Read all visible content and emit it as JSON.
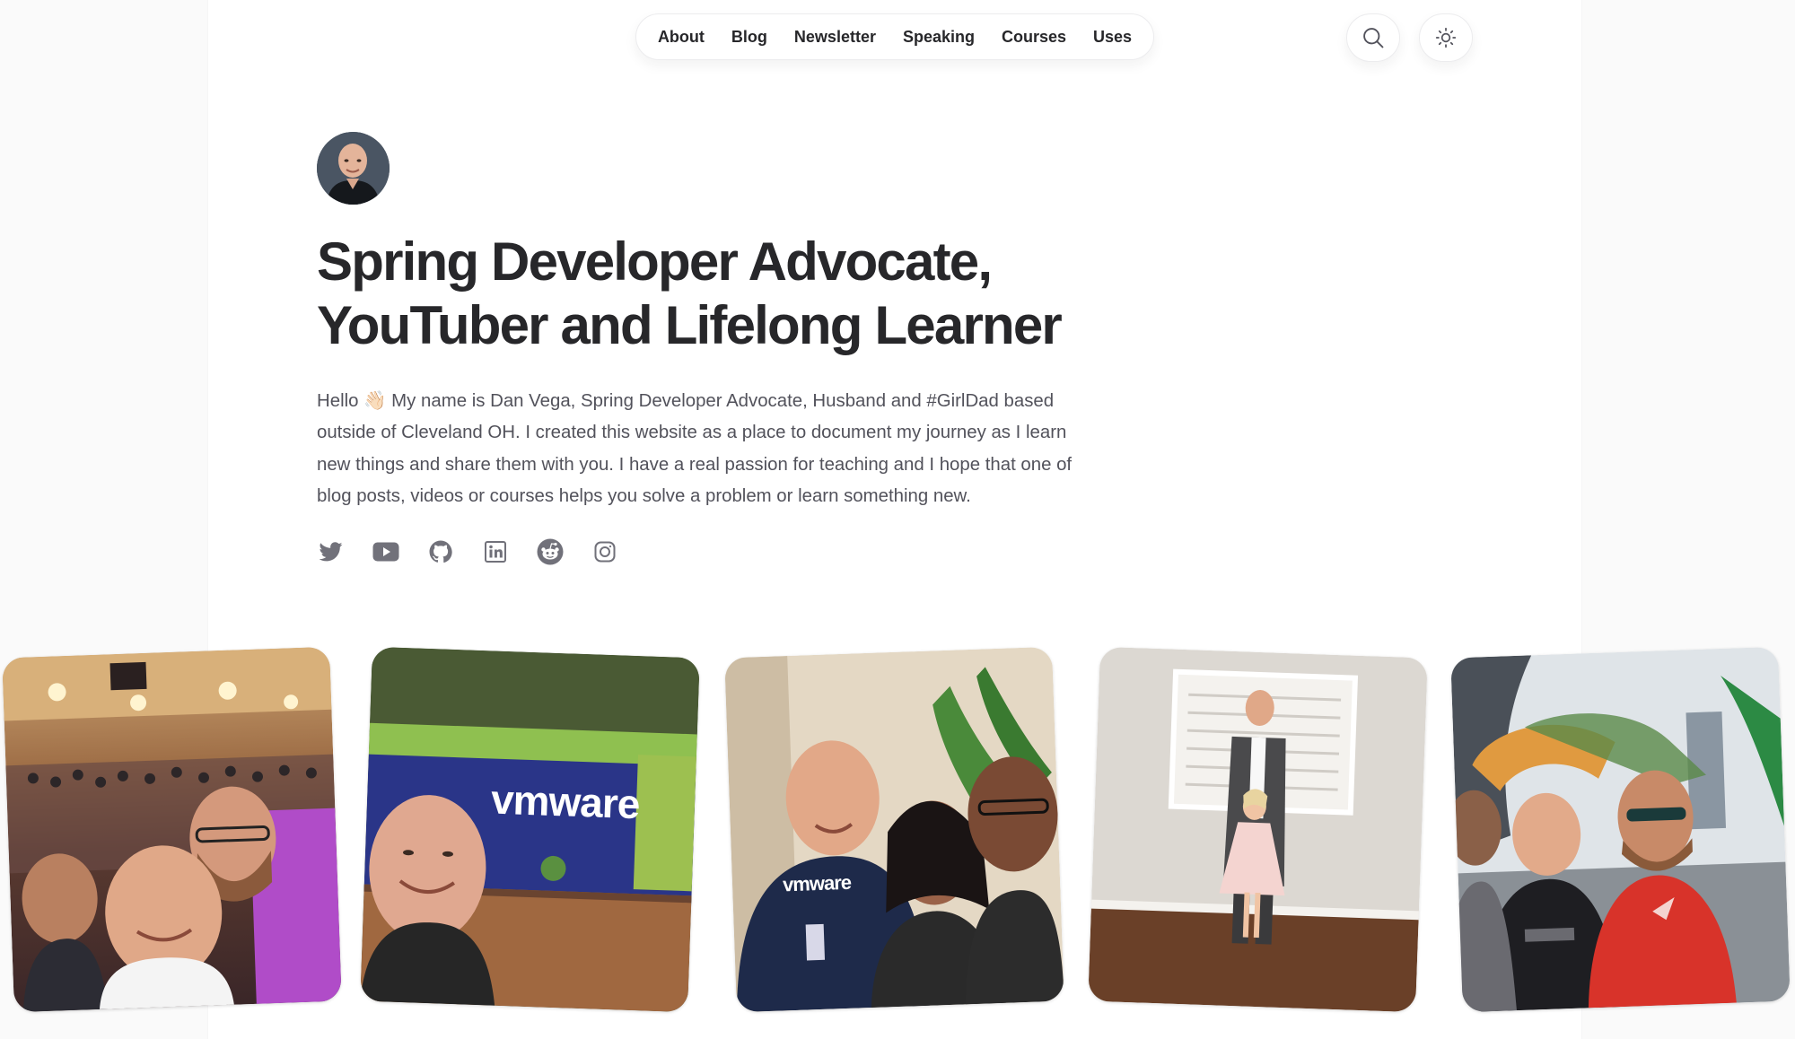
{
  "nav": {
    "items": [
      "About",
      "Blog",
      "Newsletter",
      "Speaking",
      "Courses",
      "Uses"
    ]
  },
  "header_buttons": {
    "search_icon": "search-icon",
    "theme_icon": "sun-icon"
  },
  "hero": {
    "headline_line1": "Spring Developer Advocate,",
    "headline_line2": "YouTuber and Lifelong Learner",
    "bio_lines": [
      "Hello 👋🏻 My name is Dan Vega, Spring Developer Advocate, Husband and #GirlDad based",
      "outside of Cleveland OH. I created this website as a place to document my journey as I learn",
      "new things and share them with you. I have a real passion for teaching and I hope that one of",
      "blog posts, videos or courses helps you solve a problem or learn something new."
    ]
  },
  "socials": [
    "twitter-icon",
    "youtube-icon",
    "github-icon",
    "linkedin-icon",
    "reddit-icon",
    "instagram-icon"
  ],
  "photos": {
    "sign_text": "vmware",
    "shirt_text": "vmware"
  },
  "colors": {
    "text": "#27272a",
    "muted": "#52525b",
    "icon": "#71717a",
    "background": "#fafafa",
    "card": "#ffffff"
  }
}
